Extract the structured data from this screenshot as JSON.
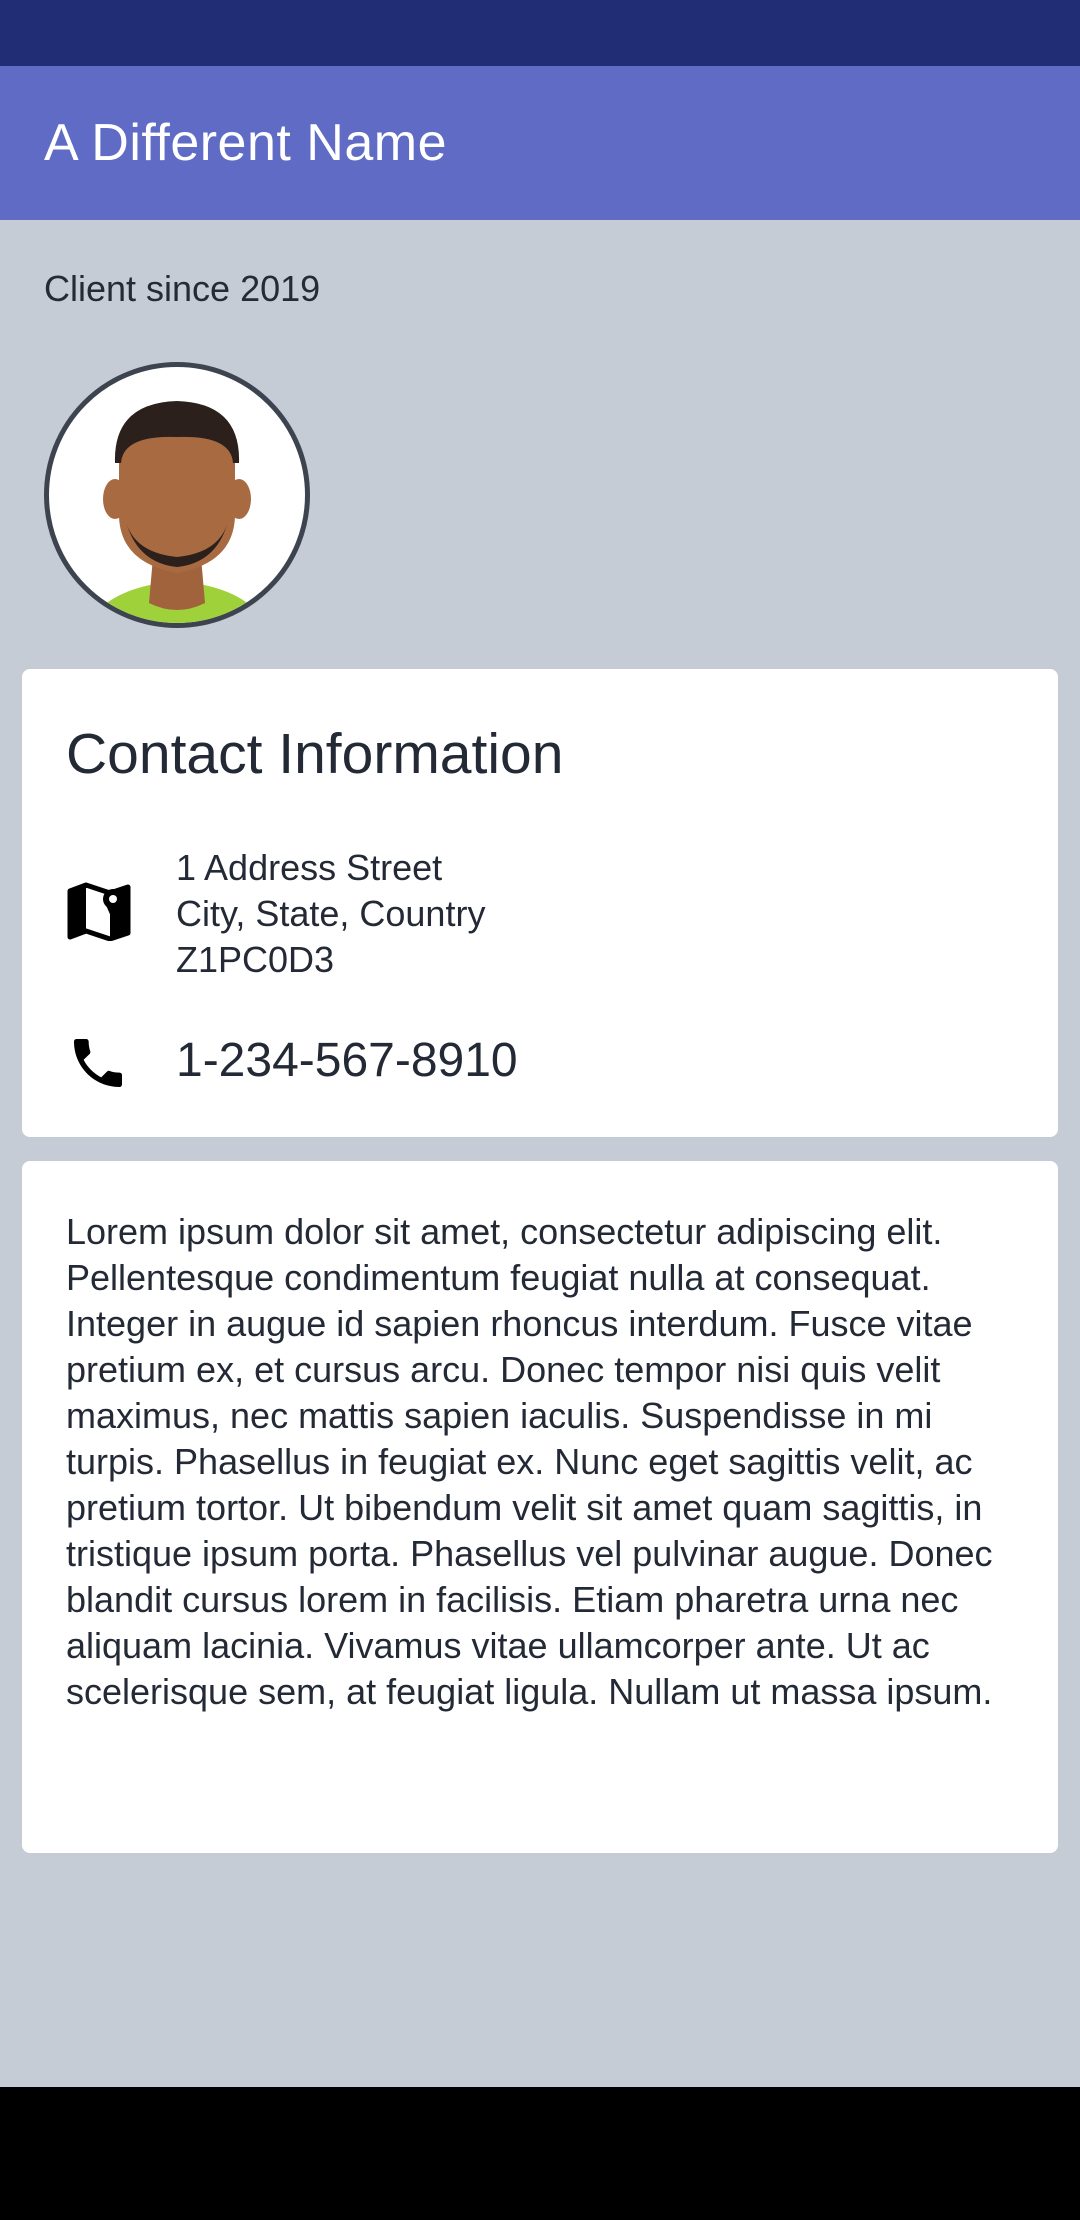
{
  "app_bar": {
    "title": "A Different Name"
  },
  "client": {
    "since_label": "Client since 2019"
  },
  "contact": {
    "title": "Contact Information",
    "address": {
      "line1": "1 Address Street",
      "line2": "City, State, Country",
      "line3": "Z1PC0D3"
    },
    "phone": "1-234-567-8910"
  },
  "bio": {
    "text": "Lorem ipsum dolor sit amet, consectetur adipiscing elit. Pellentesque condimentum feugiat nulla at consequat. Integer in augue id sapien rhoncus interdum. Fusce vitae pretium ex, et cursus arcu. Donec tempor nisi quis velit maximus, nec mattis sapien iaculis. Suspendisse in mi turpis. Phasellus in feugiat ex. Nunc eget sagittis velit, ac pretium tortor. Ut bibendum velit sit amet quam sagittis, in tristique ipsum porta. Phasellus vel pulvinar augue. Donec blandit cursus lorem in facilisis. Etiam pharetra urna nec aliquam lacinia. Vivamus vitae ullamcorper ante. Ut ac scelerisque sem, at feugiat ligula. Nullam ut massa ipsum."
  },
  "icons": {
    "map": "map-icon",
    "phone": "phone-icon",
    "avatar": "avatar"
  },
  "colors": {
    "status_bar": "#212d74",
    "app_bar": "#5f6bc4",
    "background": "#c5ccd6",
    "card": "#ffffff",
    "text": "#232a36"
  }
}
